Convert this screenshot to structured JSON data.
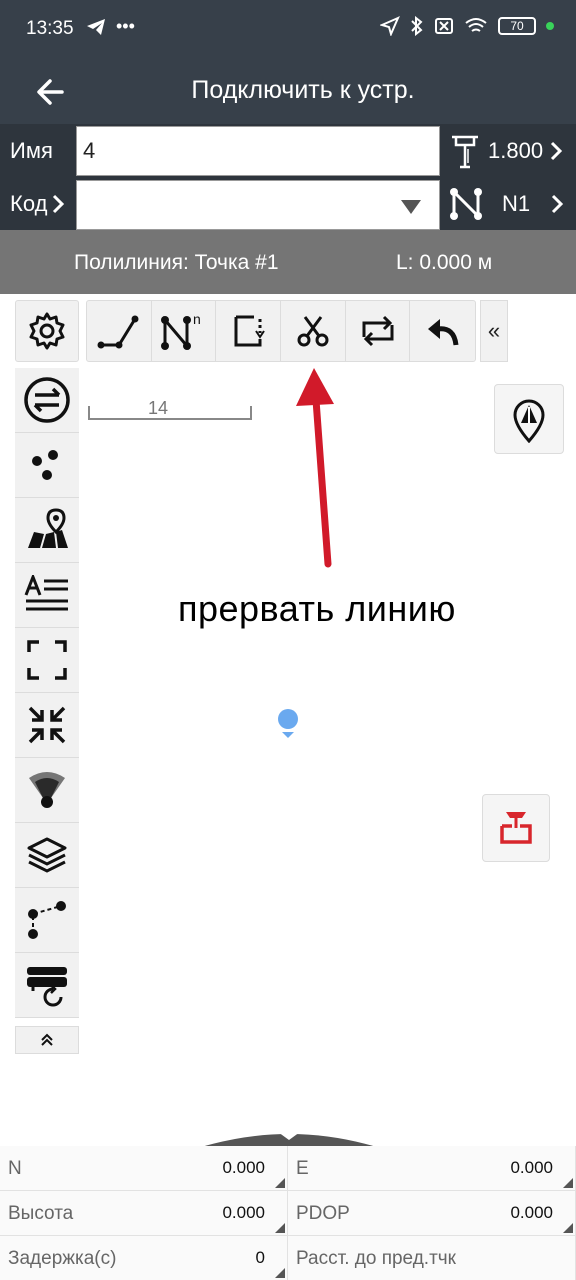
{
  "status_bar": {
    "time": "13:35",
    "battery": "70"
  },
  "header": {
    "title": "Подключить к устр."
  },
  "form": {
    "name_label": "Имя",
    "name_value": "4",
    "height_value": "1.800",
    "code_label": "Код",
    "code_value": "",
    "point_label": "N1"
  },
  "polyline_bar": {
    "name": "Полилиния: Точка #1",
    "length": "L: 0.000 м"
  },
  "toolbar": {
    "collapse_label": "«"
  },
  "map": {
    "scale_value": "14",
    "annotation": "прервать линию",
    "expand_label": "⌃"
  },
  "bottom": {
    "cells": [
      {
        "label": "N",
        "value": "0.000"
      },
      {
        "label": "E",
        "value": "0.000"
      },
      {
        "label": "Высота",
        "value": "0.000"
      },
      {
        "label": "PDOP",
        "value": "0.000"
      },
      {
        "label": "Задержка(с)",
        "value": "0"
      },
      {
        "label": "Расст. до пред.тчк",
        "value": ""
      }
    ]
  },
  "colors": {
    "header_bg": "#37404a",
    "row_bg": "#2e353d",
    "polyline_bg": "#757575",
    "arrow": "#d11a2a",
    "marker": "#6aa9ef",
    "accent_red": "#d8262c"
  }
}
